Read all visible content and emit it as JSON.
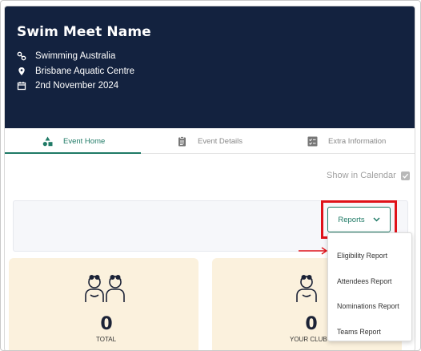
{
  "event": {
    "title": "Swim Meet Name",
    "organisation": "Swimming Australia",
    "venue": "Brisbane Aquatic Centre",
    "date": "2nd November 2024"
  },
  "tabs": [
    {
      "label": "Event Home",
      "active": true,
      "icon": "shapes-icon"
    },
    {
      "label": "Event Details",
      "active": false,
      "icon": "clipboard-icon"
    },
    {
      "label": "Extra Information",
      "active": false,
      "icon": "checklist-icon"
    }
  ],
  "calendar": {
    "label": "Show in Calendar",
    "checked": true
  },
  "reports": {
    "button_label": "Reports",
    "menu": [
      "Eligibility Report",
      "Attendees Report",
      "Nominations Report",
      "Teams Report"
    ]
  },
  "stats": [
    {
      "value": "0",
      "label": "TOTAL"
    },
    {
      "value": "0",
      "label": "YOUR CLUB'S"
    }
  ],
  "colors": {
    "hero_bg": "#13223f",
    "accent": "#1f7a66",
    "highlight": "#e0121a",
    "stat_bg": "#fbf1dd"
  }
}
